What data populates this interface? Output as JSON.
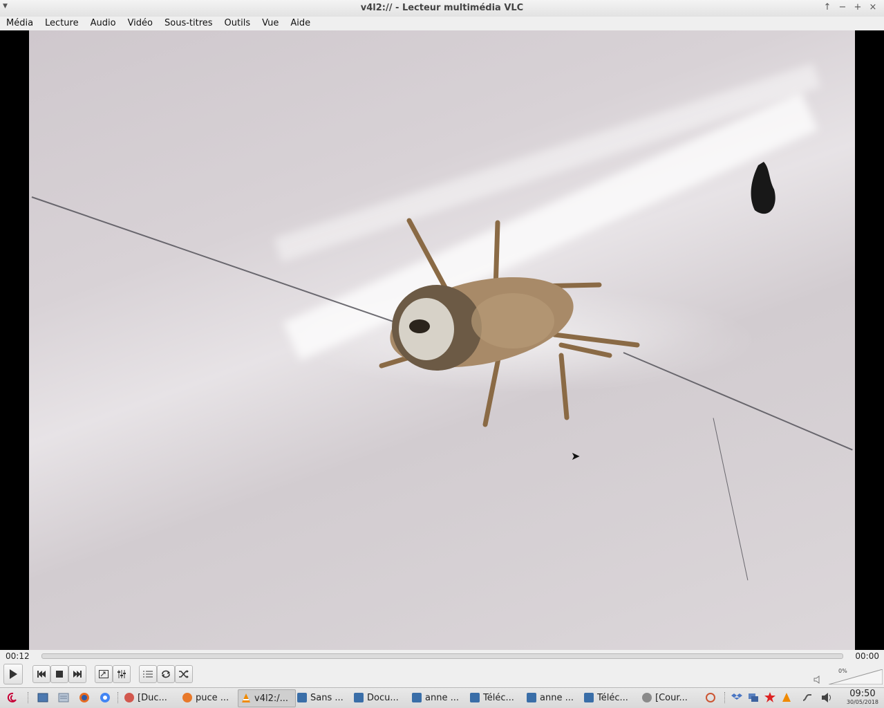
{
  "window": {
    "title": "v4l2:// - Lecteur multimédia VLC",
    "controls": [
      "↑",
      "−",
      "+",
      "×"
    ]
  },
  "menubar": [
    "Média",
    "Lecture",
    "Audio",
    "Vidéo",
    "Sous-titres",
    "Outils",
    "Vue",
    "Aide"
  ],
  "playback": {
    "elapsed": "00:12",
    "total": "00:00",
    "progress": 0
  },
  "volume": {
    "percent_label": "0%",
    "level": 0
  },
  "taskbar": {
    "tasks": [
      {
        "label": "[Duc...",
        "icon": "chromium-icon",
        "color": "#d2584e"
      },
      {
        "label": "puce ...",
        "icon": "firefox-icon",
        "color": "#e8792a"
      },
      {
        "label": "v4l2:/...",
        "icon": "vlc-icon",
        "color": "#f08a00"
      },
      {
        "label": "Sans ...",
        "icon": "document-icon",
        "color": "#3a6ea8"
      },
      {
        "label": "Docu...",
        "icon": "folder-icon",
        "color": "#3a6ea8"
      },
      {
        "label": "anne ...",
        "icon": "mail-icon",
        "color": "#3a6ea8"
      },
      {
        "label": "Téléc...",
        "icon": "download-icon",
        "color": "#3a6ea8"
      },
      {
        "label": "anne ...",
        "icon": "mail-icon",
        "color": "#3a6ea8"
      },
      {
        "label": "Téléc...",
        "icon": "download-icon",
        "color": "#3a6ea8"
      },
      {
        "label": "[Cour...",
        "icon": "chromium-icon",
        "color": "#8a8a8a"
      }
    ],
    "clock": {
      "time": "09:50",
      "date": "30/05/2018"
    }
  },
  "colors": {
    "vlc_orange": "#f08a00",
    "debian_red": "#c70036"
  }
}
